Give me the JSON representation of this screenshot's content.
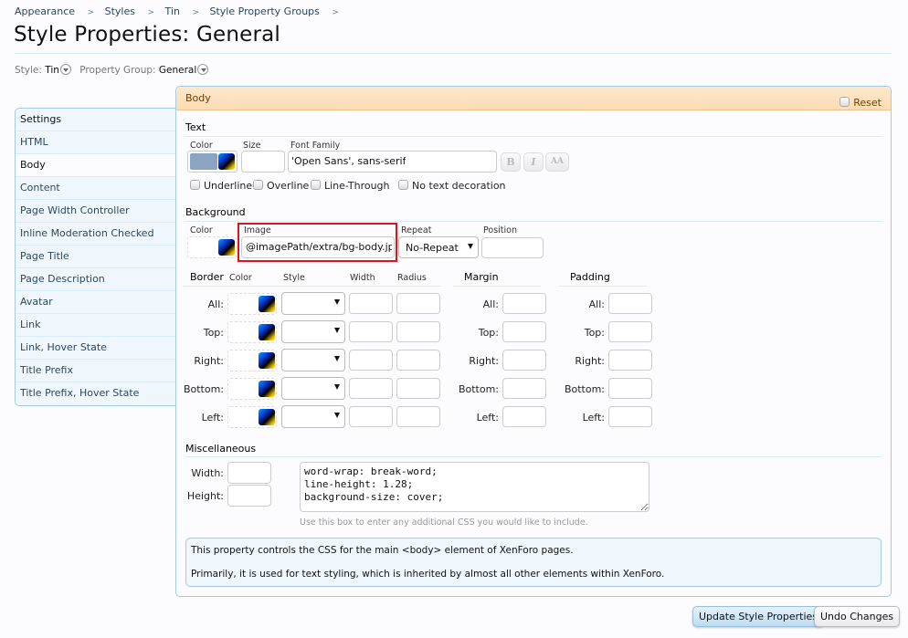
{
  "breadcrumb": [
    "Appearance",
    "Styles",
    "Tin",
    "Style Property Groups"
  ],
  "breadcrumb_separator": ">",
  "page_title": "Style Properties: General",
  "selectors": {
    "style_label": "Style:",
    "style_value": "Tin",
    "group_label": "Property Group:",
    "group_value": "General"
  },
  "sidebar": {
    "active": "Body",
    "items": [
      {
        "label": "Settings"
      },
      {
        "label": "HTML"
      },
      {
        "label": "Body"
      },
      {
        "label": "Content"
      },
      {
        "label": "Page Width Controller"
      },
      {
        "label": "Inline Moderation Checked"
      },
      {
        "label": "Page Title"
      },
      {
        "label": "Page Description"
      },
      {
        "label": "Avatar"
      },
      {
        "label": "Link"
      },
      {
        "label": "Link, Hover State"
      },
      {
        "label": "Title Prefix"
      },
      {
        "label": "Title Prefix, Hover State"
      }
    ]
  },
  "panel": {
    "title": "Body",
    "reset_label": "Reset",
    "text": {
      "section_title": "Text",
      "color_label": "Color",
      "color_value": "#8ba4c2",
      "size_label": "Size",
      "size_value": "",
      "font_family_label": "Font Family",
      "font_family_value": "'Open Sans', sans-serif",
      "bold_label": "B",
      "italic_label": "I",
      "caps_label": "AA",
      "decorations": [
        "Underline",
        "Overline",
        "Line-Through",
        "No text decoration"
      ]
    },
    "background": {
      "section_title": "Background",
      "color_label": "Color",
      "image_label": "Image",
      "image_value": "@imagePath/extra/bg-body.jp",
      "repeat_label": "Repeat",
      "repeat_value": "No-Repeat",
      "position_label": "Position",
      "position_value": ""
    },
    "border": {
      "section_title": "Border",
      "columns": [
        "Color",
        "Style",
        "Width",
        "Radius"
      ],
      "rows": [
        "All:",
        "Top:",
        "Right:",
        "Bottom:",
        "Left:"
      ]
    },
    "margin": {
      "section_title": "Margin",
      "rows": [
        "All:",
        "Top:",
        "Right:",
        "Bottom:",
        "Left:"
      ]
    },
    "padding": {
      "section_title": "Padding",
      "rows": [
        "All:",
        "Top:",
        "Right:",
        "Bottom:",
        "Left:"
      ]
    },
    "misc": {
      "section_title": "Miscellaneous",
      "width_label": "Width:",
      "height_label": "Height:",
      "extra_css": "word-wrap: break-word;\nline-height: 1.28;\nbackground-size: cover;",
      "hint": "Use this box to enter any additional CSS you would like to include."
    },
    "explain": [
      "This property controls the CSS for the main <body> element of XenForo pages.",
      "Primarily, it is used for text styling, which is inherited by almost all other elements within XenForo."
    ]
  },
  "buttons": {
    "update": "Update Style Properties",
    "undo": "Undo Changes"
  },
  "colors": {
    "highlight_box": "#e0131c",
    "header_bg": "#fbdcb4",
    "accent_border": "#a5cae4"
  }
}
